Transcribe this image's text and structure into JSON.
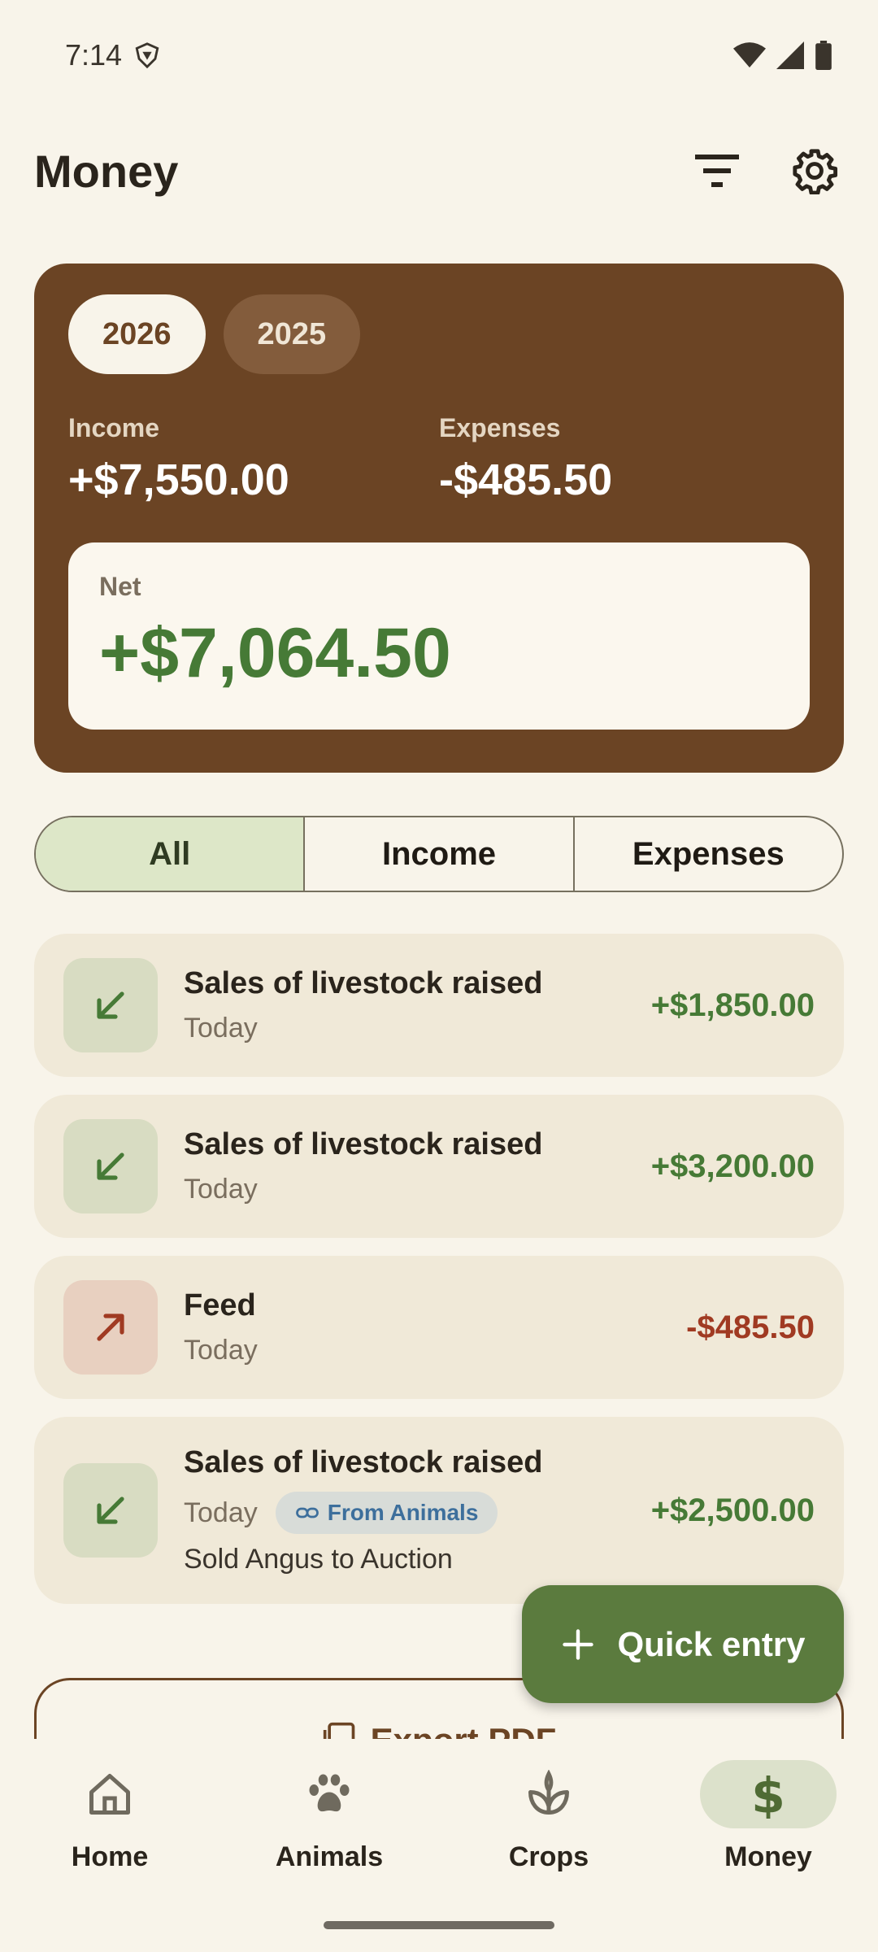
{
  "status": {
    "time": "7:14"
  },
  "app": {
    "title": "Money"
  },
  "summary": {
    "years": [
      {
        "label": "2026",
        "active": true
      },
      {
        "label": "2025",
        "active": false
      }
    ],
    "income_label": "Income",
    "income_value": "+$7,550.00",
    "expenses_label": "Expenses",
    "expenses_value": "-$485.50",
    "net_label": "Net",
    "net_value": "+$7,064.50"
  },
  "filter": {
    "all": "All",
    "income": "Income",
    "expenses": "Expenses",
    "selected": "All"
  },
  "transactions": [
    {
      "title": "Sales of livestock raised",
      "date": "Today",
      "amount": "+$1,850.00",
      "type": "income"
    },
    {
      "title": "Sales of livestock raised",
      "date": "Today",
      "amount": "+$3,200.00",
      "type": "income"
    },
    {
      "title": "Feed",
      "date": "Today",
      "amount": "-$485.50",
      "type": "expense"
    },
    {
      "title": "Sales of livestock raised",
      "date": "Today",
      "amount": "+$2,500.00",
      "type": "income",
      "link": "From Animals",
      "note": "Sold Angus to Auction"
    }
  ],
  "export": {
    "label": "Export PDF"
  },
  "fab": {
    "label": "Quick entry"
  },
  "nav": {
    "home": "Home",
    "animals": "Animals",
    "crops": "Crops",
    "money": "Money",
    "active": "Money"
  },
  "colors": {
    "brand_brown": "#6b4424",
    "income_green": "#467a36",
    "expense_red": "#a03a22",
    "fab_green": "#5b7b3e"
  }
}
